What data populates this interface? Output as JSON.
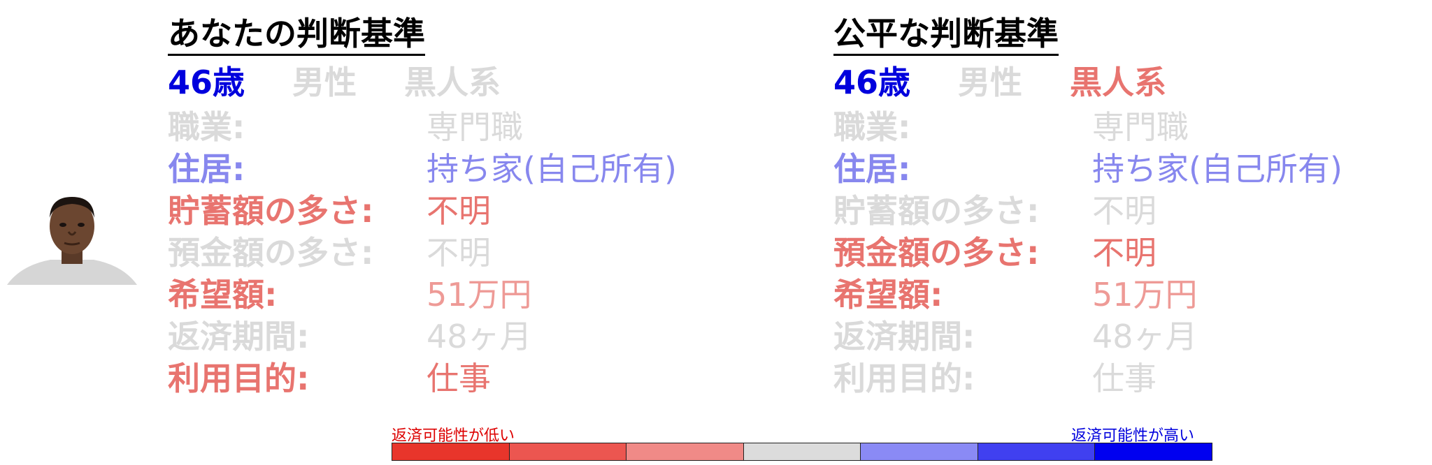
{
  "colors": {
    "gray": "#dadada",
    "blue_strong": "#0000dd",
    "blue_light": "#8787ee",
    "red_strong": "#e8746f",
    "red_light": "#ee9a96"
  },
  "left": {
    "title": "あなたの判断基準",
    "age": "46歳",
    "gender": "男性",
    "race": "黒人系",
    "rows": [
      {
        "label": "職業:",
        "value": "専門職"
      },
      {
        "label": "住居:",
        "value": "持ち家(自己所有)"
      },
      {
        "label": "貯蓄額の多さ:",
        "value": "不明"
      },
      {
        "label": "預金額の多さ:",
        "value": "不明"
      },
      {
        "label": "希望額:",
        "value": "51万円"
      },
      {
        "label": "返済期間:",
        "value": "48ヶ月"
      },
      {
        "label": "利用目的:",
        "value": "仕事"
      }
    ]
  },
  "right": {
    "title": "公平な判断基準",
    "age": "46歳",
    "gender": "男性",
    "race": "黒人系",
    "rows": [
      {
        "label": "職業:",
        "value": "専門職"
      },
      {
        "label": "住居:",
        "value": "持ち家(自己所有)"
      },
      {
        "label": "貯蓄額の多さ:",
        "value": "不明"
      },
      {
        "label": "預金額の多さ:",
        "value": "不明"
      },
      {
        "label": "希望額:",
        "value": "51万円"
      },
      {
        "label": "返済期間:",
        "value": "48ヶ月"
      },
      {
        "label": "利用目的:",
        "value": "仕事"
      }
    ]
  },
  "scale": {
    "low_label": "返済可能性が低い",
    "high_label": "返済可能性が高い",
    "segments": [
      "#e8352b",
      "#ec5650",
      "#f08a87",
      "#dcdcdc",
      "#8a8af5",
      "#4040f0",
      "#0000f0"
    ]
  }
}
